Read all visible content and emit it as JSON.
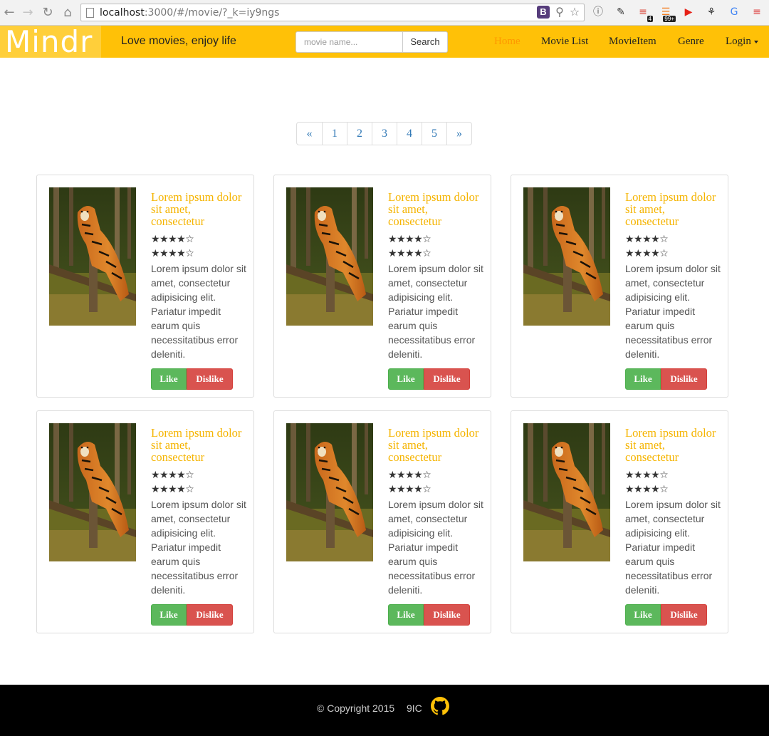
{
  "browser": {
    "url_host": "localhost",
    "url_rest": ":3000/#/movie/?_k=iy9ngs",
    "ext_badge_1": "4",
    "ext_badge_2": "99+"
  },
  "navbar": {
    "brand": "Mindr",
    "tagline": "Love movies, enjoy life",
    "search_placeholder": "movie name...",
    "search_button": "Search",
    "links": [
      "Home",
      "Movie List",
      "MovieItem",
      "Genre",
      "Login"
    ],
    "active_color": "#ff9800",
    "bg_color": "#ffc107"
  },
  "pagination": {
    "prev": "«",
    "pages": [
      "1",
      "2",
      "3",
      "4",
      "5"
    ],
    "next": "»"
  },
  "cards": [
    {
      "title": "Lorem ipsum dolor sit amet, consectetur",
      "rating1": "★★★★☆",
      "rating2": "★★★★☆",
      "description": "Lorem ipsum dolor sit amet, consectetur adipisicing elit. Pariatur impedit earum quis necessitatibus error deleniti.",
      "like": "Like",
      "dislike": "Dislike"
    },
    {
      "title": "Lorem ipsum dolor sit amet, consectetur",
      "rating1": "★★★★☆",
      "rating2": "★★★★☆",
      "description": "Lorem ipsum dolor sit amet, consectetur adipisicing elit. Pariatur impedit earum quis necessitatibus error deleniti.",
      "like": "Like",
      "dislike": "Dislike"
    },
    {
      "title": "Lorem ipsum dolor sit amet, consectetur",
      "rating1": "★★★★☆",
      "rating2": "★★★★☆",
      "description": "Lorem ipsum dolor sit amet, consectetur adipisicing elit. Pariatur impedit earum quis necessitatibus error deleniti.",
      "like": "Like",
      "dislike": "Dislike"
    },
    {
      "title": "Lorem ipsum dolor sit amet, consectetur",
      "rating1": "★★★★☆",
      "rating2": "★★★★☆",
      "description": "Lorem ipsum dolor sit amet, consectetur adipisicing elit. Pariatur impedit earum quis necessitatibus error deleniti.",
      "like": "Like",
      "dislike": "Dislike"
    },
    {
      "title": "Lorem ipsum dolor sit amet, consectetur",
      "rating1": "★★★★☆",
      "rating2": "★★★★☆",
      "description": "Lorem ipsum dolor sit amet, consectetur adipisicing elit. Pariatur impedit earum quis necessitatibus error deleniti.",
      "like": "Like",
      "dislike": "Dislike"
    },
    {
      "title": "Lorem ipsum dolor sit amet, consectetur",
      "rating1": "★★★★☆",
      "rating2": "★★★★☆",
      "description": "Lorem ipsum dolor sit amet, consectetur adipisicing elit. Pariatur impedit earum quis necessitatibus error deleniti.",
      "like": "Like",
      "dislike": "Dislike"
    }
  ],
  "footer": {
    "copyright": "© Copyright 2015",
    "org": "9IC"
  }
}
